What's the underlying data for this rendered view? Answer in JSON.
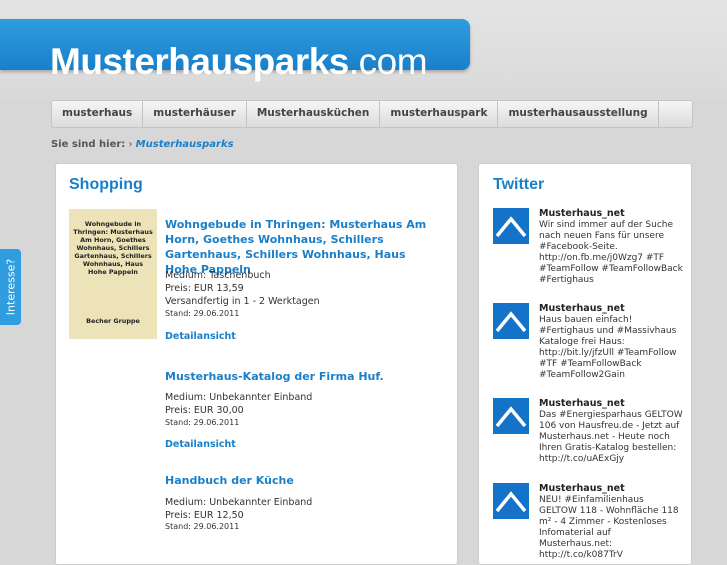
{
  "header": {
    "logo_bold": "Musterhausparks",
    "logo_tld": ".com"
  },
  "nav": [
    {
      "label": "musterhaus"
    },
    {
      "label": "musterhäuser"
    },
    {
      "label": "Musterhausküchen"
    },
    {
      "label": "musterhauspark"
    },
    {
      "label": "musterhausausstellung"
    }
  ],
  "breadcrumb": {
    "label": "Sie sind hier:",
    "sep": "›",
    "current": "Musterhausparks"
  },
  "side_tab": {
    "label": "Interesse?"
  },
  "shopping": {
    "title": "Shopping",
    "cover": {
      "text": "Wohngebude in Thringen: Musterhaus Am Horn, Goethes Wohnhaus, Schillers Gartenhaus, Schillers Wohnhaus, Haus Hohe Pappeln",
      "publisher": "Becher Gruppe"
    },
    "products": [
      {
        "title": "Wohngebude in Thringen: Musterhaus Am Horn, Goethes Wohnhaus, Schillers Gartenhaus, Schillers Wohnhaus, Haus Hohe Pappeln",
        "medium": "Medium: Taschenbuch",
        "price": "Preis: EUR 13,59",
        "shipping": "Versandfertig in 1 - 2 Werktagen",
        "stand": "Stand: 29.06.2011",
        "detail": "Detailansicht"
      },
      {
        "title": "Musterhaus-Katalog der Firma Huf.",
        "medium": "Medium: Unbekannter Einband",
        "price": "Preis: EUR 30,00",
        "stand": "Stand: 29.06.2011",
        "detail": "Detailansicht"
      },
      {
        "title": "Handbuch der Küche",
        "medium": "Medium: Unbekannter Einband",
        "price": "Preis: EUR 12,50",
        "stand": "Stand: 29.06.2011"
      }
    ]
  },
  "twitter": {
    "title": "Twitter",
    "tweets": [
      {
        "user": "Musterhaus_net",
        "text": "Wir sind immer auf der Suche nach neuen Fans für unsere #Facebook-Seite. http://on.fb.me/j0Wzg7 #TF #TeamFollow #TeamFollowBack #Fertighaus"
      },
      {
        "user": "Musterhaus_net",
        "text": "Haus bauen einfach! #Fertighaus und #Massivhaus Kataloge frei Haus: http://bit.ly/jfzUll #TeamFollow #TF #TeamFollowBack #TeamFollow2Gain"
      },
      {
        "user": "Musterhaus_net",
        "text": "Das #Energiesparhaus GELTOW 106 von Hausfreu.de - Jetzt auf Musterhaus.net - Heute noch Ihren Gratis-Katalog bestellen: http://t.co/uAExGjy"
      },
      {
        "user": "Musterhaus_net",
        "text": "NEU! #Einfamilienhaus GELTOW 118 - Wohnfläche 118 m² - 4 Zimmer - Kostenloses Infomaterial auf Musterhaus.net: http://t.co/k087TrV"
      }
    ]
  }
}
